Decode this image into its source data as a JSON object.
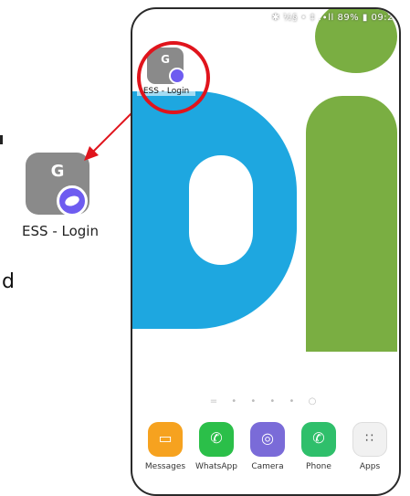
{
  "callout": {
    "label": "ESS - Login",
    "icon_letter": "G",
    "fragment_text": "d"
  },
  "phone": {
    "status_text": "✱ ½§ • ‡ .∙ll 89% ▮ 09:2",
    "home_icon": {
      "letter": "G",
      "label": "ESS - Login"
    },
    "page_indicator": "= • • • • ○",
    "dock": [
      {
        "label": "Messages",
        "icon": "messages-icon",
        "glyph": "▭"
      },
      {
        "label": "WhatsApp",
        "icon": "whatsapp-icon",
        "glyph": "✆"
      },
      {
        "label": "Camera",
        "icon": "camera-icon",
        "glyph": "◎"
      },
      {
        "label": "Phone",
        "icon": "phone-icon",
        "glyph": "✆"
      },
      {
        "label": "Apps",
        "icon": "apps-grid-icon",
        "glyph": "∷"
      }
    ]
  },
  "colors": {
    "highlight": "#e0141c",
    "wallpaper_blue": "#1ea7e0",
    "wallpaper_green": "#7aae42"
  }
}
